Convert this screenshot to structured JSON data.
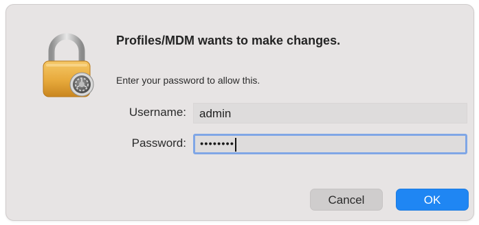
{
  "dialog": {
    "title": "Profiles/MDM wants to make changes.",
    "message": "Enter your password to allow this.",
    "icon": "lock-icon",
    "badge_icon": "system-preferences-gear-icon"
  },
  "form": {
    "username_label": "Username:",
    "username_value": "admin",
    "password_label": "Password:",
    "password_mask": "••••••••"
  },
  "buttons": {
    "cancel_label": "Cancel",
    "ok_label": "OK"
  },
  "colors": {
    "dialog_background": "#e7e4e4",
    "accent": "#1f86f3",
    "focus_ring": "#7fa6e6"
  }
}
